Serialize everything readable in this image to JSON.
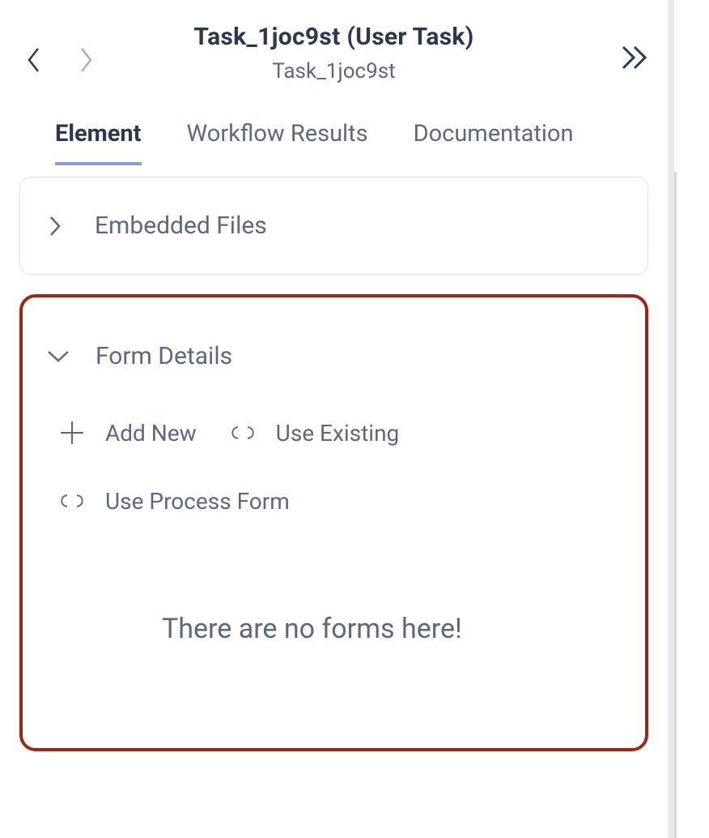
{
  "header": {
    "title": "Task_1joc9st (User Task)",
    "subtitle": "Task_1joc9st"
  },
  "tabs": {
    "element": "Element",
    "workflow_results": "Workflow Results",
    "documentation": "Documentation"
  },
  "sections": {
    "embedded_files": "Embedded Files",
    "form_details": "Form Details"
  },
  "form_actions": {
    "add_new": "Add New",
    "use_existing": "Use Existing",
    "use_process_form": "Use Process Form"
  },
  "empty_message": "There are no forms here!"
}
